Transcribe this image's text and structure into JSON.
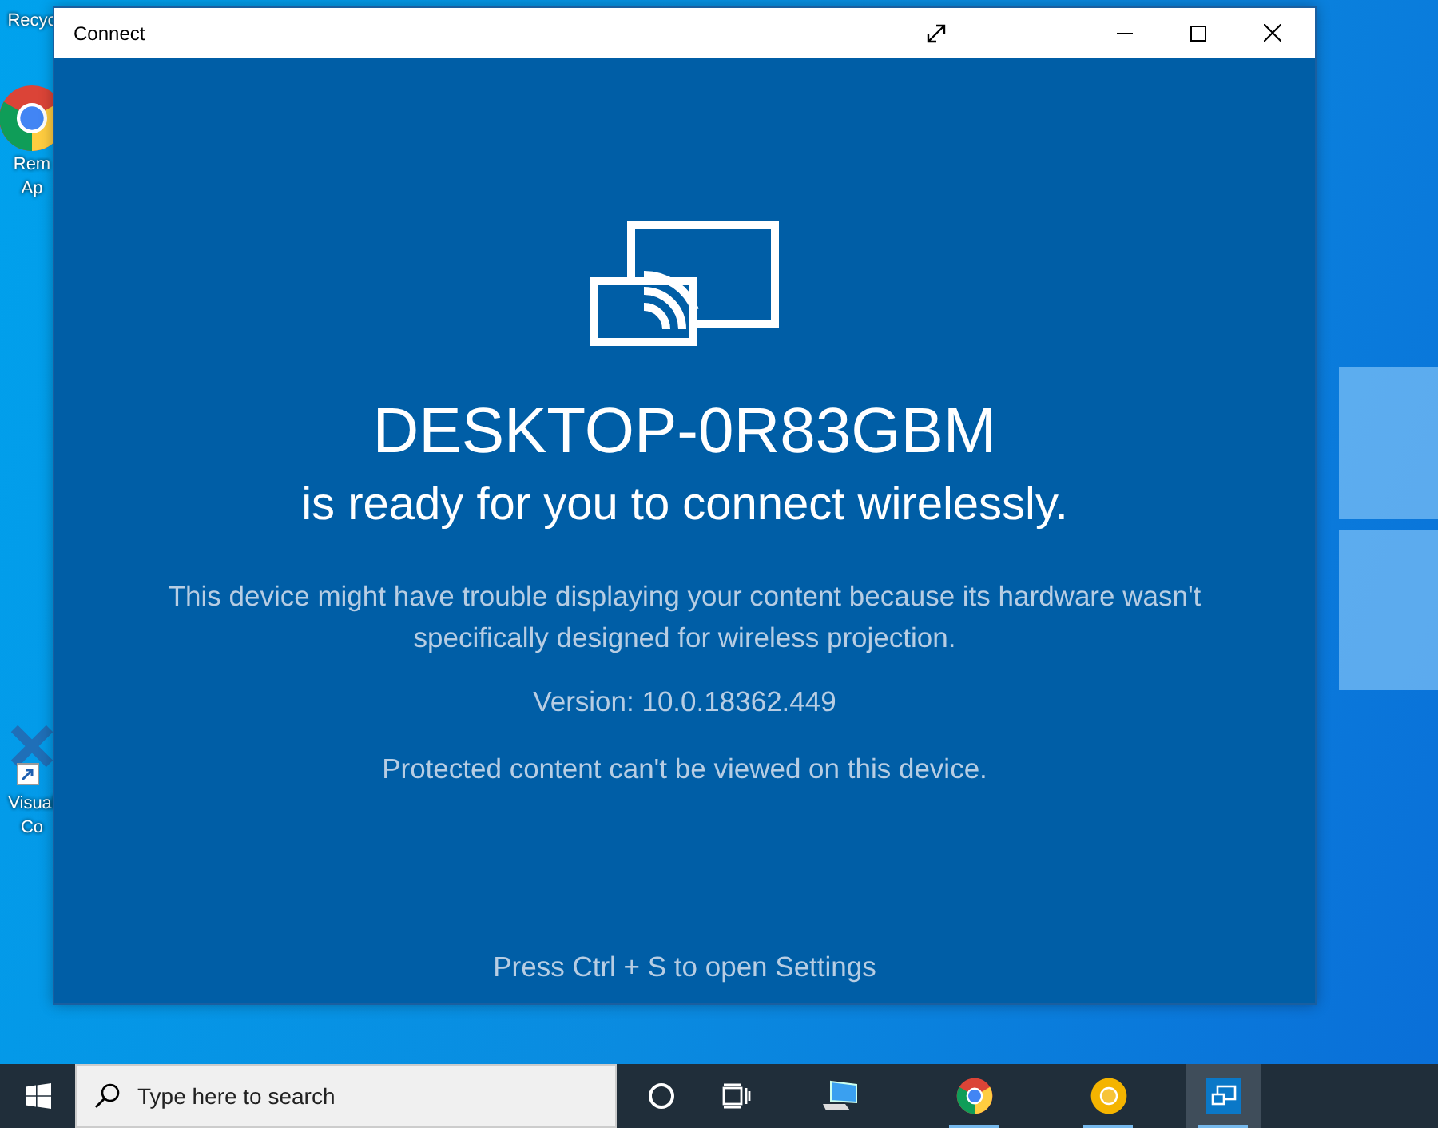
{
  "desktop": {
    "icons": [
      {
        "kind": "recycle",
        "lines": [
          "Recyc"
        ]
      },
      {
        "kind": "chrome",
        "lines": [
          "Rem",
          "Ap"
        ]
      },
      {
        "kind": "vscode",
        "lines": [
          "Visual",
          "Co"
        ]
      }
    ]
  },
  "window": {
    "title": "Connect",
    "device_name": "DESKTOP-0R83GBM",
    "subtitle": "is ready for you to connect wirelessly.",
    "warning": "This device might have trouble displaying your content because its hardware wasn't specifically designed for wireless projection.",
    "version": "Version: 10.0.18362.449",
    "protection": "Protected content can't be viewed on this device.",
    "hint": "Press Ctrl + S to open Settings"
  },
  "taskbar": {
    "search": {
      "placeholder": "Type here to search"
    },
    "items": [
      {
        "kind": "cortana",
        "running": false,
        "selected": false
      },
      {
        "kind": "taskview",
        "running": false,
        "selected": false
      },
      {
        "kind": "network",
        "running": false,
        "selected": false
      },
      {
        "kind": "chrome",
        "running": true,
        "selected": false
      },
      {
        "kind": "canary",
        "running": true,
        "selected": false
      },
      {
        "kind": "connect",
        "running": true,
        "selected": true
      }
    ]
  }
}
